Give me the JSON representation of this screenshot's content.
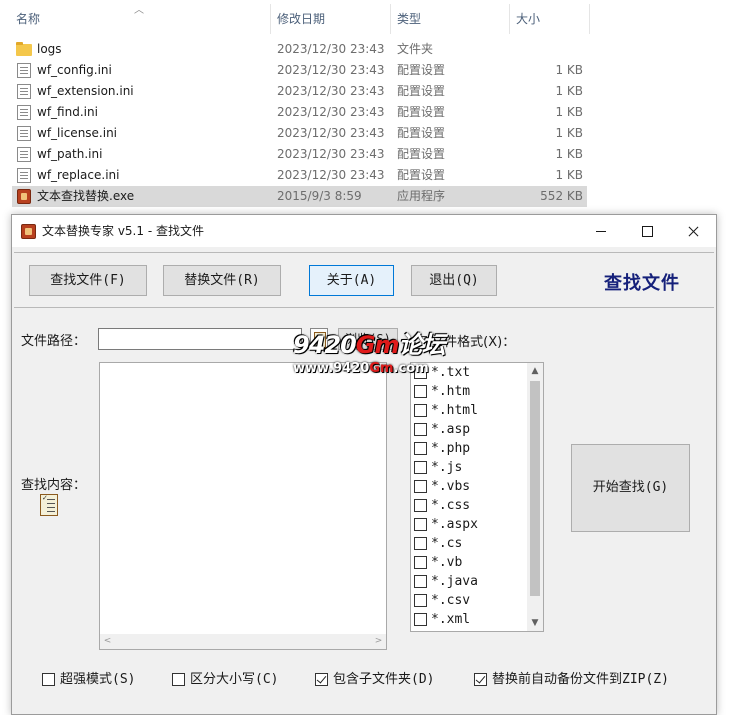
{
  "explorer": {
    "columns": {
      "name": "名称",
      "date": "修改日期",
      "type": "类型",
      "size": "大小"
    },
    "files": [
      {
        "name": "logs",
        "date": "2023/12/30 23:43",
        "type": "文件夹",
        "size": "",
        "icon": "folder-icon"
      },
      {
        "name": "wf_config.ini",
        "date": "2023/12/30 23:43",
        "type": "配置设置",
        "size": "1 KB",
        "icon": "ini-file-icon"
      },
      {
        "name": "wf_extension.ini",
        "date": "2023/12/30 23:43",
        "type": "配置设置",
        "size": "1 KB",
        "icon": "ini-file-icon"
      },
      {
        "name": "wf_find.ini",
        "date": "2023/12/30 23:43",
        "type": "配置设置",
        "size": "1 KB",
        "icon": "ini-file-icon"
      },
      {
        "name": "wf_license.ini",
        "date": "2023/12/30 23:43",
        "type": "配置设置",
        "size": "1 KB",
        "icon": "ini-file-icon"
      },
      {
        "name": "wf_path.ini",
        "date": "2023/12/30 23:43",
        "type": "配置设置",
        "size": "1 KB",
        "icon": "ini-file-icon"
      },
      {
        "name": "wf_replace.ini",
        "date": "2023/12/30 23:43",
        "type": "配置设置",
        "size": "1 KB",
        "icon": "ini-file-icon"
      },
      {
        "name": "文本查找替换.exe",
        "date": "2015/9/3 8:59",
        "type": "应用程序",
        "size": "552 KB",
        "icon": "exe-file-icon",
        "selected": true
      }
    ]
  },
  "window": {
    "title": "文本替换专家 v5.1  -  查找文件",
    "buttons": {
      "find_files": "查找文件(F)",
      "replace_files": "替换文件(R)",
      "about": "关于(A)",
      "exit": "退出(Q)"
    },
    "panel_title": "查找文件",
    "path_label": "文件路径：",
    "path_value": "",
    "browse": "浏览(S)",
    "file_format_label": "文件格式(X)：",
    "find_content_label": "查找内容：",
    "file_types": [
      "*.txt",
      "*.htm",
      "*.html",
      "*.asp",
      "*.php",
      "*.js",
      "*.vbs",
      "*.css",
      "*.aspx",
      "*.cs",
      "*.vb",
      "*.java",
      "*.csv",
      "*.xml"
    ],
    "start_button": "开始查找(G)",
    "options": [
      {
        "label": "超强模式(S)",
        "checked": false
      },
      {
        "label": "区分大小写(C)",
        "checked": false
      },
      {
        "label": "包含子文件夹(D)",
        "checked": true
      },
      {
        "label": "替换前自动备份文件到ZIP(Z)",
        "checked": true
      }
    ]
  },
  "watermark": {
    "line1_a": "9420",
    "line1_b": "Gm",
    "line1_c": "论坛",
    "line2_a": "www.9420",
    "line2_b": "Gm",
    "line2_c": ".com"
  }
}
